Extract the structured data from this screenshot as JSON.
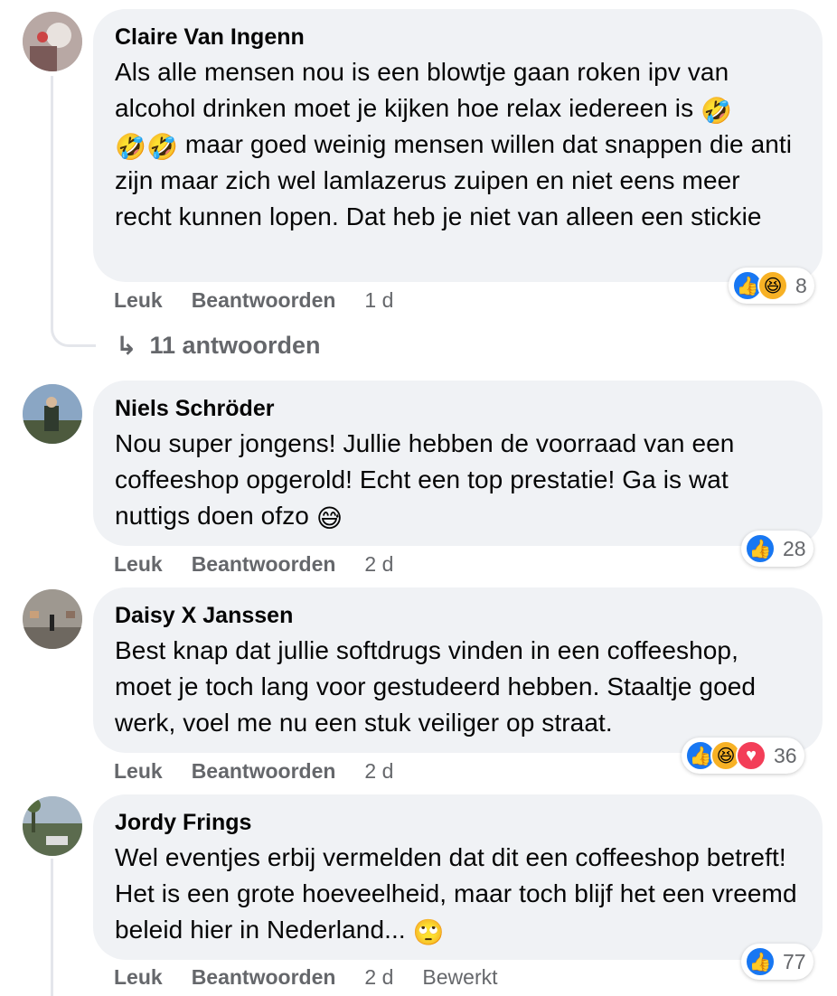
{
  "comments": [
    {
      "author": "Claire Van Ingenn",
      "text_parts": [
        "Als alle mensen nou is een blowtje gaan roken ipv van alcohol drinken moet je kijken hoe relax iedereen is ",
        "🤣",
        " ",
        "🤣🤣",
        " maar goed weinig mensen willen dat snappen die anti zijn maar zich wel lamlazerus zuipen en niet eens meer recht kunnen lopen. Dat heb je niet van alleen een stickie"
      ],
      "like_label": "Leuk",
      "reply_label": "Beantwoorden",
      "time": "1 d",
      "reaction_count": "8",
      "reaction_icons": [
        "like-icon",
        "haha-icon"
      ],
      "replies_label": "11 antwoorden"
    },
    {
      "author": "Niels Schröder",
      "text_parts": [
        "Nou super jongens! Jullie hebben de voorraad van een coffeeshop opgerold! Echt een top prestatie! Ga is wat nuttigs doen ofzo ",
        "😅"
      ],
      "like_label": "Leuk",
      "reply_label": "Beantwoorden",
      "time": "2 d",
      "reaction_count": "28",
      "reaction_icons": [
        "like-icon"
      ]
    },
    {
      "author": "Daisy X Janssen",
      "text_parts": [
        "Best knap dat jullie softdrugs vinden in een coffeeshop, moet je toch lang voor gestudeerd hebben. Staaltje goed werk, voel me nu een stuk veiliger op straat."
      ],
      "like_label": "Leuk",
      "reply_label": "Beantwoorden",
      "time": "2 d",
      "reaction_count": "36",
      "reaction_icons": [
        "like-icon",
        "haha-icon",
        "love-icon"
      ]
    },
    {
      "author": "Jordy Frings",
      "text_parts": [
        "Wel eventjes erbij vermelden dat dit een coffeeshop betreft! Het is een grote hoeveelheid, maar toch blijf het een vreemd beleid hier in Nederland... ",
        "🙄"
      ],
      "like_label": "Leuk",
      "reply_label": "Beantwoorden",
      "time": "2 d",
      "edited_label": "Bewerkt",
      "reaction_count": "77",
      "reaction_icons": [
        "like-icon"
      ]
    }
  ],
  "colors": {
    "bubble": "#f0f2f5",
    "meta_text": "#65676b",
    "like_blue": "#1877f2",
    "haha_yellow": "#f7b125",
    "love_red": "#f33e58"
  }
}
